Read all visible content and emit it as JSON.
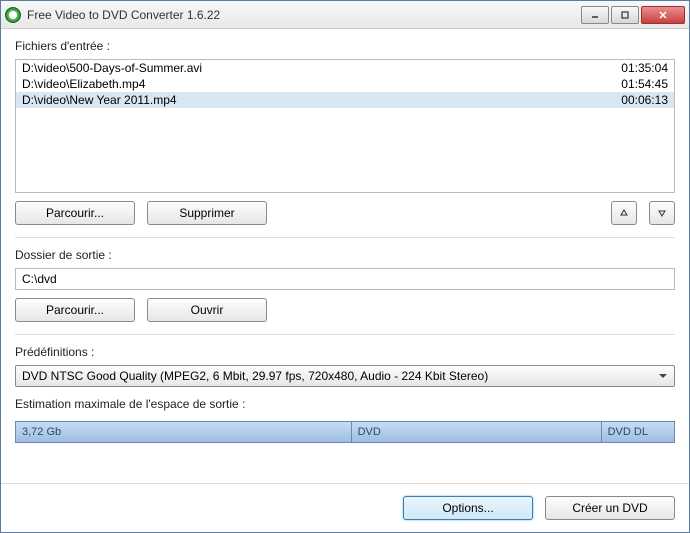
{
  "title": "Free Video to DVD Converter 1.6.22",
  "input": {
    "label": "Fichiers d'entrée :",
    "files": [
      {
        "path": "D:\\video\\500-Days-of-Summer.avi",
        "duration": "01:35:04"
      },
      {
        "path": "D:\\video\\Elizabeth.mp4",
        "duration": "01:54:45"
      },
      {
        "path": "D:\\video\\New Year 2011.mp4",
        "duration": "00:06:13"
      }
    ],
    "selected_index": 2,
    "browse": "Parcourir...",
    "remove": "Supprimer"
  },
  "output": {
    "label": "Dossier de sortie :",
    "path": "C:\\dvd",
    "browse": "Parcourir...",
    "open": "Ouvrir"
  },
  "presets": {
    "label": "Prédéfinitions :",
    "selected": "DVD NTSC Good Quality (MPEG2, 6 Mbit, 29.97 fps, 720x480, Audio - 224 Kbit Stereo)"
  },
  "space": {
    "label": "Estimation maximale de l'espace de sortie :",
    "size": "3,72 Gb",
    "dvd": "DVD",
    "dvddl": "DVD DL"
  },
  "footer": {
    "options": "Options...",
    "create": "Créer un DVD"
  }
}
